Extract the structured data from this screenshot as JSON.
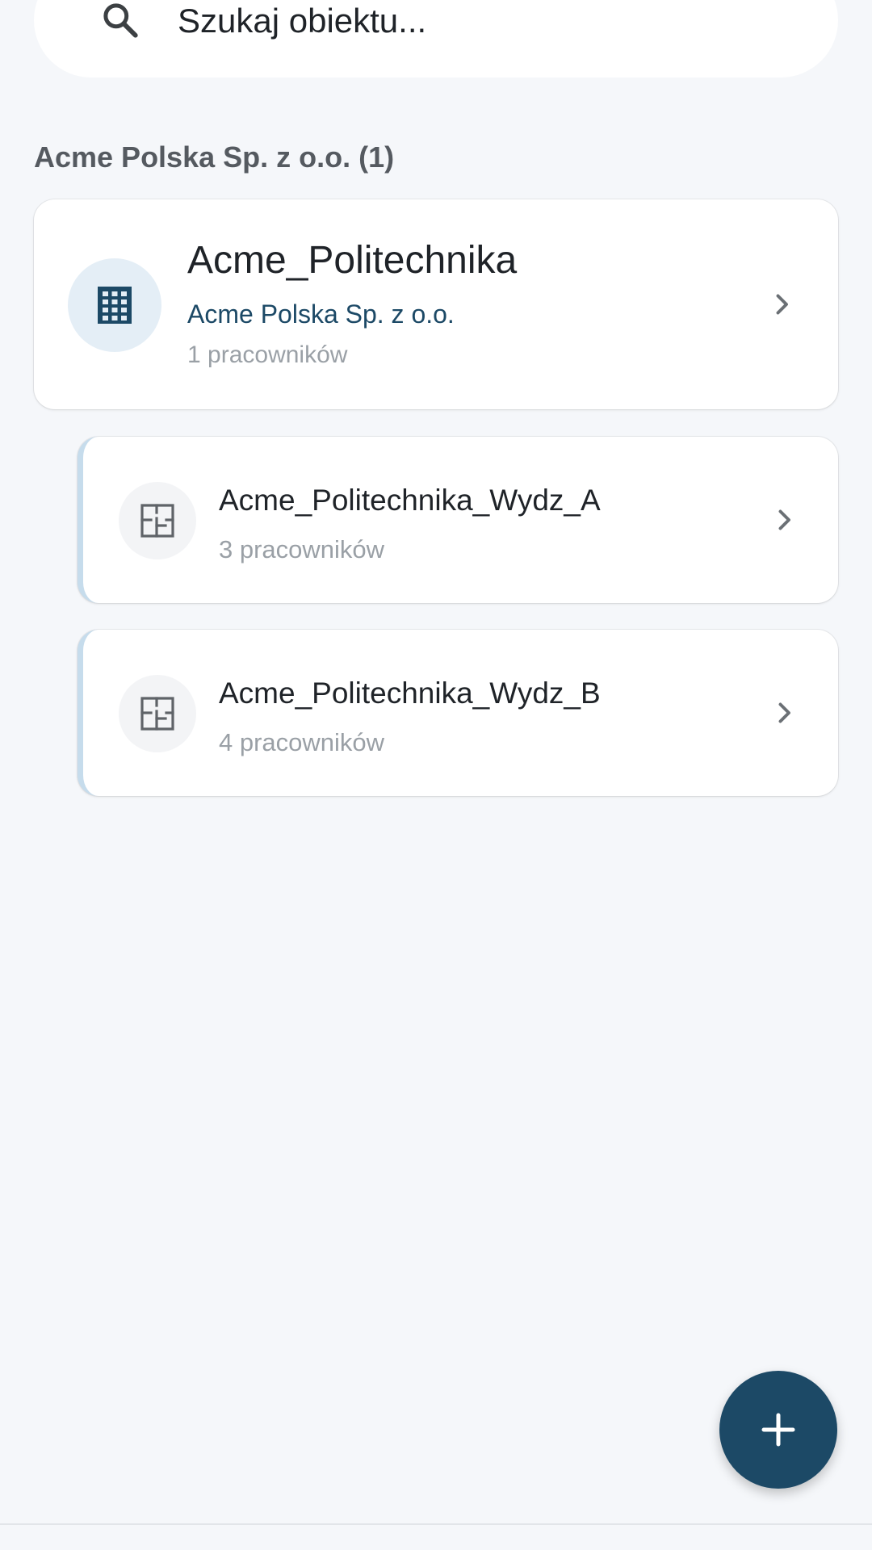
{
  "search": {
    "placeholder": "Szukaj obiektu...",
    "icon": "search-icon"
  },
  "group": {
    "heading": "Acme Polska Sp. z o.o. (1)"
  },
  "main_item": {
    "title": "Acme_Politechnika",
    "subtitle": "Acme Polska Sp. z o.o.",
    "count": "1 pracowników",
    "icon": "building-icon"
  },
  "sub_items": [
    {
      "title": "Acme_Politechnika_Wydz_A",
      "count": "3 pracowników",
      "icon": "floor-plan-icon"
    },
    {
      "title": "Acme_Politechnika_Wydz_B",
      "count": "4 pracowników",
      "icon": "floor-plan-icon"
    }
  ],
  "fab": {
    "icon": "plus-icon"
  },
  "colors": {
    "primary": "#1c4966",
    "background": "#f5f7fa",
    "avatar_bg": "#e4eef6",
    "sub_border": "#c6dcec",
    "muted_text": "#9aa0a6"
  }
}
